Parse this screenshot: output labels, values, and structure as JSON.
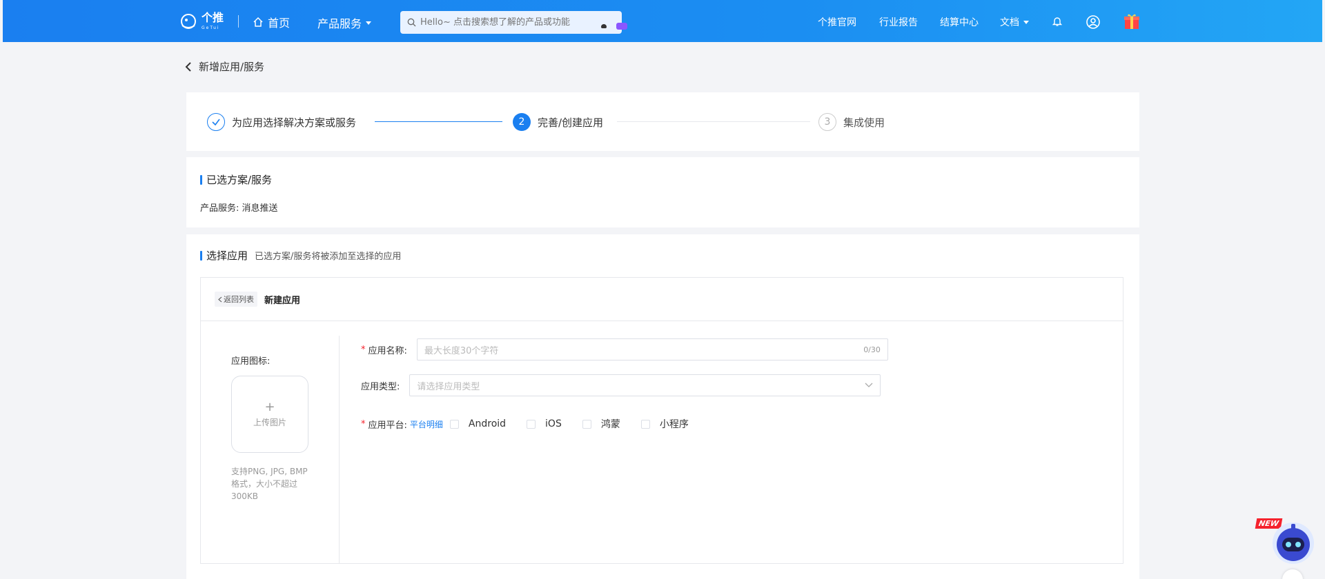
{
  "nav": {
    "logo_text": "个推",
    "logo_sub": "GeTui",
    "home": "首页",
    "products": "产品服务",
    "search_placeholder": "Hello~ 点击搜索想了解的产品或功能",
    "links": [
      "个推官网",
      "行业报告",
      "结算中心",
      "文档"
    ]
  },
  "page": {
    "back_title": "新增应用/服务"
  },
  "steps": [
    {
      "label": "为应用选择解决方案或服务",
      "state": "done"
    },
    {
      "number": "2",
      "label": "完善/创建应用",
      "state": "active"
    },
    {
      "number": "3",
      "label": "集成使用",
      "state": "pending"
    }
  ],
  "selected": {
    "title": "已选方案/服务",
    "service_label": "产品服务:",
    "service_value": "消息推送"
  },
  "choose": {
    "title": "选择应用",
    "subtitle": "已选方案/服务将被添加至选择的应用",
    "back_list": "返回列表",
    "new_app": "新建应用",
    "icon_label": "应用图标:",
    "upload_plus": "+",
    "upload_text": "上传图片",
    "icon_hint": "支持PNG, JPG, BMP格式，大小不超过300KB",
    "name_label": "应用名称:",
    "name_placeholder": "最大长度30个字符",
    "name_counter": "0/30",
    "type_label": "应用类型:",
    "type_placeholder": "请选择应用类型",
    "platform_label": "应用平台:",
    "platform_link": "平台明细",
    "platforms": [
      "Android",
      "iOS",
      "鸿蒙",
      "小程序"
    ]
  },
  "assistant": {
    "new_tag": "NEW"
  },
  "colors": {
    "brand": "#1a7ff0",
    "required": "#f5222d"
  }
}
